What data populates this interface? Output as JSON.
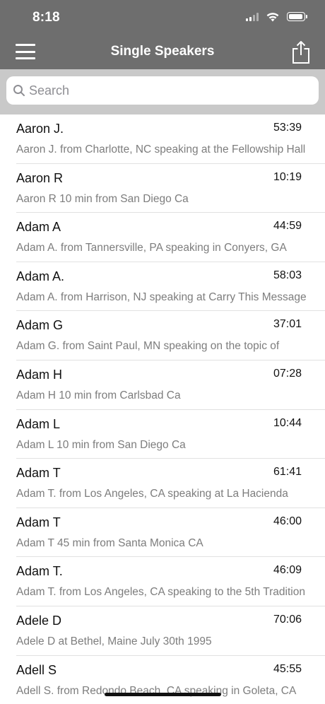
{
  "status_bar": {
    "time": "8:18"
  },
  "nav": {
    "title": "Single Speakers",
    "menu_icon": "hamburger-menu-icon",
    "share_icon": "share-icon"
  },
  "search": {
    "placeholder": "Search",
    "value": ""
  },
  "speakers": [
    {
      "name": "Aaron J.",
      "duration": "53:39",
      "description": "Aaron J. from Charlotte, NC speaking at the Fellowship Hall"
    },
    {
      "name": "Aaron R",
      "duration": "10:19",
      "description": "Aaron R 10 min from San Diego Ca"
    },
    {
      "name": "Adam A",
      "duration": "44:59",
      "description": "Adam A. from Tannersville, PA speaking in Conyers, GA"
    },
    {
      "name": "Adam A.",
      "duration": "58:03",
      "description": "Adam A. from Harrison, NJ speaking at Carry This Message"
    },
    {
      "name": "Adam G",
      "duration": "37:01",
      "description": "Adam G. from Saint Paul, MN speaking on the topic of"
    },
    {
      "name": "Adam H",
      "duration": "07:28",
      "description": "Adam H 10 min from Carlsbad Ca"
    },
    {
      "name": "Adam L",
      "duration": "10:44",
      "description": "Adam L 10 min from San Diego Ca"
    },
    {
      "name": "Adam T",
      "duration": "61:41",
      "description": "Adam T. from Los Angeles, CA speaking at La Hacienda"
    },
    {
      "name": "Adam T",
      "duration": "46:00",
      "description": "Adam T 45 min from Santa Monica CA"
    },
    {
      "name": "Adam T.",
      "duration": "46:09",
      "description": "Adam T. from Los Angeles, CA speaking to the 5th Tradition"
    },
    {
      "name": "Adele D",
      "duration": "70:06",
      "description": "Adele D at Bethel, Maine July 30th 1995"
    },
    {
      "name": "Adell S",
      "duration": "45:55",
      "description": "Adell S. from Redondo Beach, CA speaking in Goleta, CA"
    }
  ]
}
